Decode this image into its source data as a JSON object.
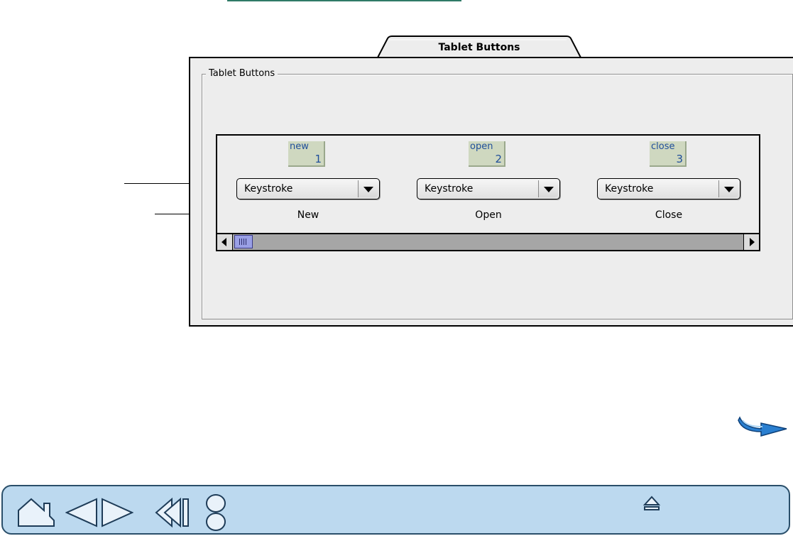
{
  "panel": {
    "tab_title": "Tablet Buttons",
    "group_title": "Tablet Buttons"
  },
  "buttons": [
    {
      "label_name": "new",
      "number": "1",
      "action": "Keystroke",
      "caption": "New"
    },
    {
      "label_name": "open",
      "number": "2",
      "action": "Keystroke",
      "caption": "Open"
    },
    {
      "label_name": "close",
      "number": "3",
      "action": "Keystroke",
      "caption": "Close"
    }
  ],
  "scrollbar": {
    "position": 0
  },
  "icons": {
    "next_page": "next-page-arrow-icon",
    "home": "home-icon",
    "back": "previous-page-icon",
    "forward": "next-page-icon",
    "history": "back-history-icon",
    "contents": "index-circles-icon",
    "eject": "eject-icon"
  },
  "colors": {
    "nav_bar": "#bcd9ef",
    "label_box": "#cfd8c0",
    "label_text": "#1f4e9a",
    "thumb": "#9aa0e6"
  }
}
